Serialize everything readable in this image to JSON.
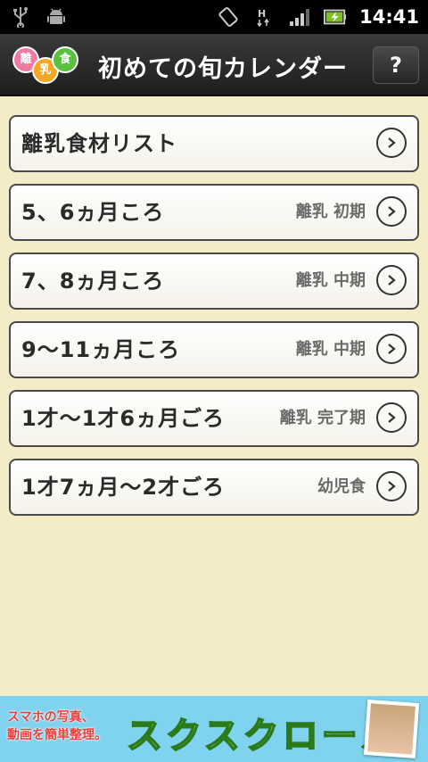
{
  "statusbar": {
    "time": "14:41",
    "left_icons": [
      "usb-icon",
      "android-debug-icon"
    ],
    "right_icons": [
      "rotate-icon",
      "hspa-icon",
      "signal-icon",
      "battery-charging-icon"
    ]
  },
  "header": {
    "logo_chars": [
      "離",
      "乳",
      "食"
    ],
    "title": "初めての旬カレンダー",
    "help_label": "?"
  },
  "list": [
    {
      "label": "離乳食材リスト",
      "stage": ""
    },
    {
      "label": "5、6ヵ月ころ",
      "stage": "離乳 初期"
    },
    {
      "label": "7、8ヵ月ころ",
      "stage": "離乳 中期"
    },
    {
      "label": "9～11ヵ月ころ",
      "stage": "離乳 中期"
    },
    {
      "label": "1才～1才6ヵ月ごろ",
      "stage": "離乳 完了期"
    },
    {
      "label": "1才7ヵ月～2才ごろ",
      "stage": "幼児食"
    }
  ],
  "ad": {
    "line1": "スマホの写真、",
    "line2": "動画を簡単整理。",
    "brand": "スクスクロール"
  },
  "colors": {
    "background": "#f3ecc7",
    "titlebar": "#2a2a2a",
    "ad_background": "#7fd3ef"
  }
}
